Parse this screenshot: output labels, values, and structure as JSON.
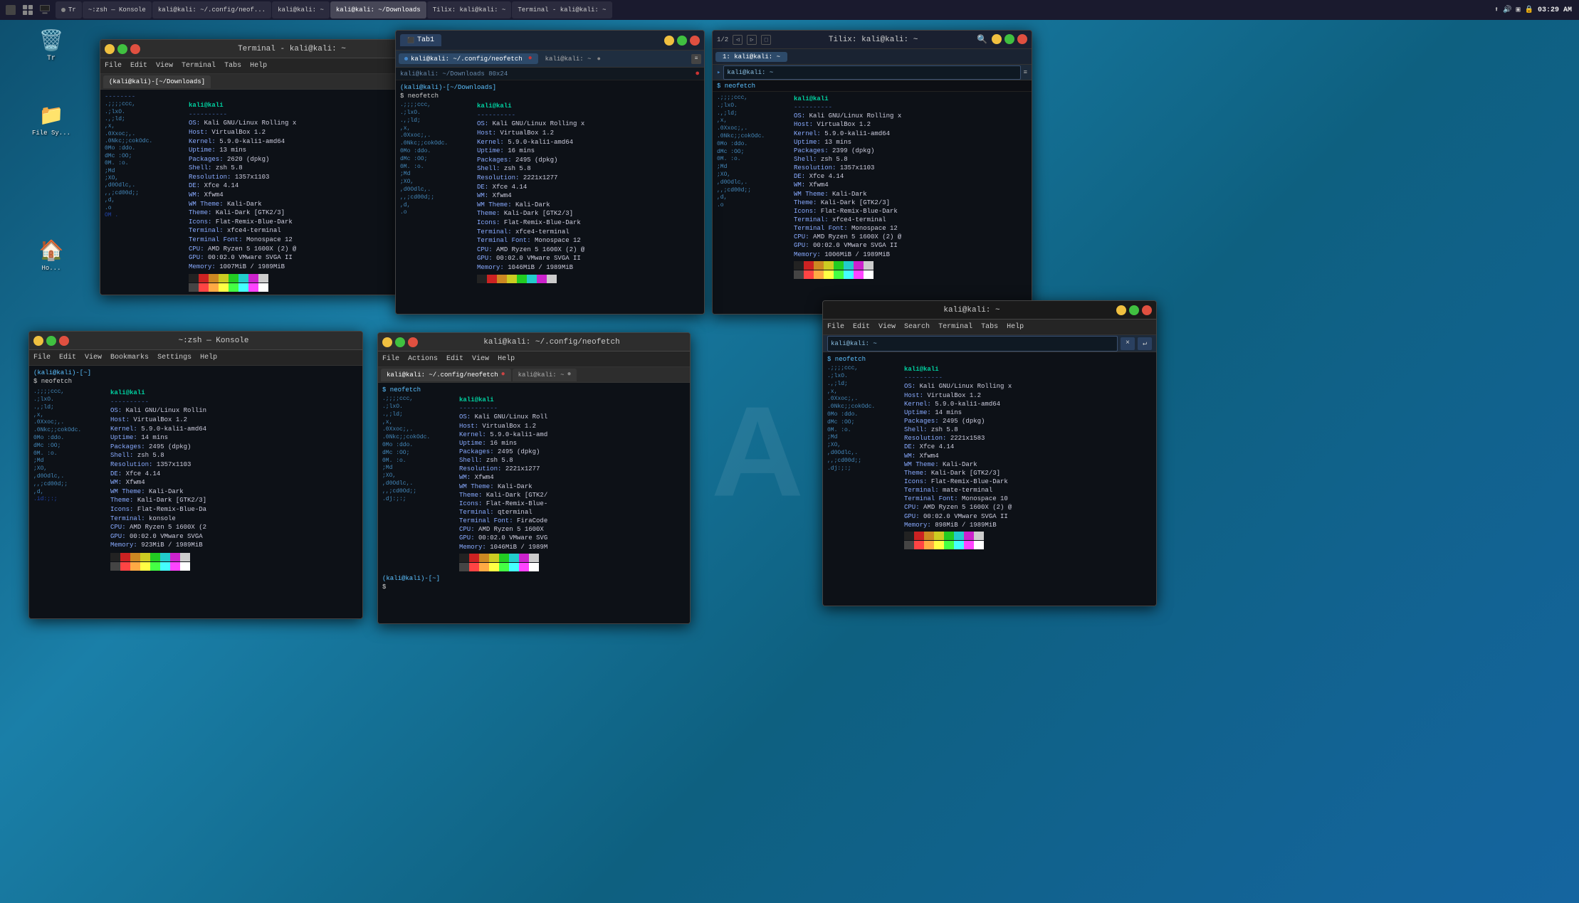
{
  "taskbar": {
    "time": "03:29 AM",
    "apps": [
      {
        "label": "Tr",
        "active": false
      },
      {
        "label": "~:zsh — Konsole",
        "active": false
      },
      {
        "label": "kali@kali: ~/.config/neof...",
        "active": false
      },
      {
        "label": "kali@kali: ~",
        "active": false
      },
      {
        "label": "kali@kali: ~/Downloads",
        "active": true
      },
      {
        "label": "Tilix: kali@kali: ~",
        "active": false
      },
      {
        "label": "Terminal - kali@kali: ~",
        "active": false
      }
    ],
    "network_icon": "🌐",
    "volume_icon": "🔊",
    "battery_icon": "🔋",
    "lock_icon": "🔒"
  },
  "windows": {
    "terminal_topleft": {
      "title": "Terminal - kali@kali: ~",
      "menu": [
        "File",
        "Edit",
        "View",
        "Terminal",
        "Tabs",
        "Help"
      ],
      "tabs": [
        "(kali@kali)-[~/Downloads]"
      ],
      "neofetch": {
        "user": "kali@kali",
        "os": "Kali GNU/Linux Rolling x",
        "host": "VirtualBox 1.2",
        "kernel": "5.9.0-kali1-amd64",
        "uptime": "13 mins",
        "packages": "2620 (dpkg)",
        "shell": "zsh 5.8",
        "resolution": "1357x1103",
        "de": "Xfce 4.14",
        "wm": "Xfwm4",
        "wm_theme": "Kali-Dark",
        "theme": "Kali-Dark [GTK2/3]",
        "icons": "Flat-Remix-Blue-Dark",
        "terminal": "xfce4-terminal",
        "terminal_font": "Monospace 12",
        "cpu": "AMD Ryzen 5 1600X (2) @",
        "gpu": "00:02.0 VMware SVGA II",
        "memory": "1007MiB / 1989MiB"
      }
    },
    "konsole": {
      "title": "~:zsh — Konsole",
      "menu": [
        "File",
        "Edit",
        "View",
        "Bookmarks",
        "Settings",
        "Help"
      ],
      "neofetch": {
        "user": "kali@kali",
        "os": "Kali GNU/Linux Rollin",
        "host": "VirtualBox 1.2",
        "kernel": "5.9.0-kali1-amd64",
        "uptime": "14 mins",
        "packages": "2495 (dpkg)",
        "shell": "zsh 5.8",
        "resolution": "1357x1103",
        "de": "Xfce 4.14",
        "wm": "Xfwm4",
        "wm_theme": "Kali-Dark",
        "theme": "Kali-Dark [GTK2/3]",
        "icons": "Flat-Remix-Blue-Da",
        "terminal": "konsole",
        "cpu": "AMD Ryzen 5 1600X (2",
        "gpu": "00:02.0 VMware SVGA",
        "memory": "923MiB / 1989MiB"
      }
    },
    "tilix_bottom": {
      "title": "kali@kali: ~/Downloads",
      "tab1": "Tab1",
      "tab2": "kali@kali: ~/Downloads 80x24",
      "inner_tabs": [
        "kali@kali: ~/.config/neofetch",
        "kali@kali: ~"
      ],
      "neofetch": {
        "user": "kali@kali",
        "os": "Kali GNU/Linux Rolling x",
        "host": "VirtualBox 1.2",
        "kernel": "5.9.0-kali1-amd64",
        "uptime": "16 mins",
        "packages": "2495 (dpkg)",
        "shell": "zsh 5.8",
        "resolution": "2221x1277",
        "de": "Xfce 4.14",
        "wm": "Xfwm4",
        "wm_theme": "Kali-Dark",
        "theme": "Kali-Dark [GTK2/3]",
        "icons": "Flat-Remix-Blue-Dark",
        "terminal": "xfce4-terminal",
        "terminal_font": "Monospace 12",
        "cpu": "AMD Ryzen 5 1600X (2) @",
        "gpu": "00:02.0 VMware SVGA II",
        "memory": "1046MiB / 1989MiB"
      }
    },
    "tilix_main": {
      "title": "Tilix: kali@kali: ~",
      "nav_label": "1/2",
      "tabs": [
        "1: kali@kali: ~"
      ],
      "addr": "kali@kali: ~",
      "neofetch": {
        "user": "kali@kali",
        "os": "Kali GNU/Linux Rolling x",
        "host": "VirtualBox 1.2",
        "kernel": "5.9.0-kali1-amd64",
        "uptime": "13 mins",
        "packages": "2399 (dpkg)",
        "shell": "zsh 5.8",
        "resolution": "1357x1103",
        "de": "Xfce 4.14",
        "wm": "Xfwm4",
        "wm_theme": "Kali-Dark",
        "theme": "Kali-Dark [GTK2/3]",
        "icons": "Flat-Remix-Blue-Dark",
        "terminal": "xfce4-terminal",
        "terminal_font": "Monospace 12",
        "cpu": "AMD Ryzen 5 1600X (2) @",
        "gpu": "00:02.0 VMware SVGA II",
        "memory": "1006MiB / 1989MiB"
      }
    },
    "neofetch_config": {
      "title": "kali@kali: ~/.config/neofetch",
      "menu": [
        "File",
        "Actions",
        "Edit",
        "View",
        "Help"
      ],
      "tabs": [
        "kali@kali: ~/.config/neofetch",
        "kali@kali: ~"
      ],
      "neofetch": {
        "user": "kali@kali",
        "os": "Kali GNU/Linux Roll",
        "host": "VirtualBox 1.2",
        "kernel": "5.9.0-kali1-amd",
        "uptime": "16 mins",
        "packages": "2495 (dpkg)",
        "shell": "zsh 5.8",
        "resolution": "2221x1277",
        "de": "Xfce 4.14",
        "wm": "Xfwm4",
        "wm_theme": "Kali-Dark",
        "theme": "Kali-Dark [GTK2/",
        "icons": "Flat-Remix-Blue-",
        "terminal_font": "FiraCode",
        "cpu": "AMD Ryzen 5 1600X",
        "gpu": "00:02.0 VMware SVG",
        "memory": "1046MiB / 1989M"
      }
    },
    "terminal_right": {
      "title": "kali@kali: ~",
      "menu": [
        "File",
        "Edit",
        "View",
        "Search",
        "Terminal",
        "Tabs",
        "Help"
      ],
      "addr": "kali@kali: ~",
      "neofetch": {
        "user": "kali@kali",
        "os": "Kali GNU/Linux Rolling x",
        "host": "VirtualBox 1.2",
        "kernel": "5.9.0-kali1-amd64",
        "uptime": "14 mins",
        "packages": "2495 (dpkg)",
        "shell": "zsh 5.8",
        "resolution": "2221x1583",
        "de": "Xfce 4.14",
        "wm": "Xfwm4",
        "wm_theme": "Kali-Dark",
        "theme": "Kali-Dark [GTK2/3]",
        "icons": "Flat-Remix-Blue-Dark",
        "terminal": "mate-terminal",
        "terminal_font": "Monospace 10",
        "cpu": "AMD Ryzen 5 1600X (2) @",
        "gpu": "00:02.0 VMware SVGA II",
        "memory": "898MiB / 1989MiB"
      }
    }
  },
  "colors": {
    "taskbar_bg": "#1a1a2e",
    "window_bg": "#0d1117",
    "window_header": "#2d2d2d",
    "accent": "#4488ff",
    "terminal_green": "#00d0a0",
    "terminal_blue": "#4488cc",
    "text_dim": "#888888",
    "text_bright": "#ffffff",
    "kali_blue": "#0078a0"
  },
  "color_swatches": [
    "#222222",
    "#cc2222",
    "#cc8822",
    "#cccc22",
    "#22cc22",
    "#22cccc",
    "#cc22cc",
    "#cccccc",
    "#444444",
    "#ff4444",
    "#ffaa44",
    "#ffff44",
    "#44ff44",
    "#44ffff",
    "#ff44ff",
    "#ffffff"
  ],
  "bottom_swatches": [
    "#222222",
    "#cc2222",
    "#cc8822",
    "#cccc22",
    "#22cc22",
    "#22cccc",
    "#cc22cc",
    "#cccccc"
  ]
}
